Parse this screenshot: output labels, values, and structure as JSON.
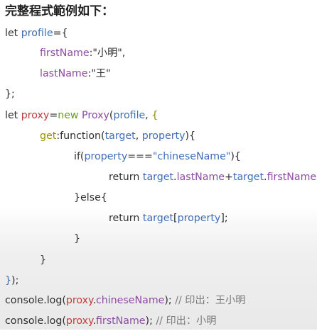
{
  "heading": "完整程式範例如下：",
  "code": {
    "l1": {
      "kw": "let",
      "var": "profile",
      "eq": "={"
    },
    "l2": {
      "key": "firstName",
      "sep": ":",
      "str": "\"小明\","
    },
    "l3": {
      "key": "lastName",
      "sep": ":",
      "str": "\"王\""
    },
    "l4": {
      "text": "};"
    },
    "l5": {
      "kw": "let",
      "var": "proxy",
      "eq": "=",
      "new": "new",
      "cls": "Proxy",
      "paren": "(",
      "arg": "profile",
      "comma": ",",
      "brace": "{"
    },
    "l6": {
      "get": "get",
      "fn": ":function(",
      "p1": "target",
      "comma": ",",
      "p2": "property",
      "close": "){"
    },
    "l7": {
      "if": "if(",
      "prop": "property",
      "op": "===",
      "str": "\"chineseName\"",
      "close": "){"
    },
    "l8": {
      "ret": "return",
      "t1": "target",
      "dot1": ".",
      "f1": "lastName",
      "plus": "+",
      "t2": "target",
      "dot2": ".",
      "f2": "firstName",
      "semi": ";"
    },
    "l9": {
      "text": "}else{"
    },
    "l10": {
      "ret": "return",
      "t1": "target",
      "open": "[",
      "prop": "property",
      "close": "];"
    },
    "l11": {
      "text": "}"
    },
    "l12": {
      "text": "}"
    },
    "l13": {
      "brace": "}",
      "rest": ");"
    },
    "l14": {
      "pre": "console.log(",
      "obj": "proxy",
      "dot": ".",
      "prop": "chineseName",
      "post": ");",
      "cm": " // 印出：王小明"
    },
    "l15": {
      "pre": "console.log(",
      "obj": "proxy",
      "dot": ".",
      "prop": "firstName",
      "post": ");",
      "cm": " // 印出：小明"
    }
  }
}
